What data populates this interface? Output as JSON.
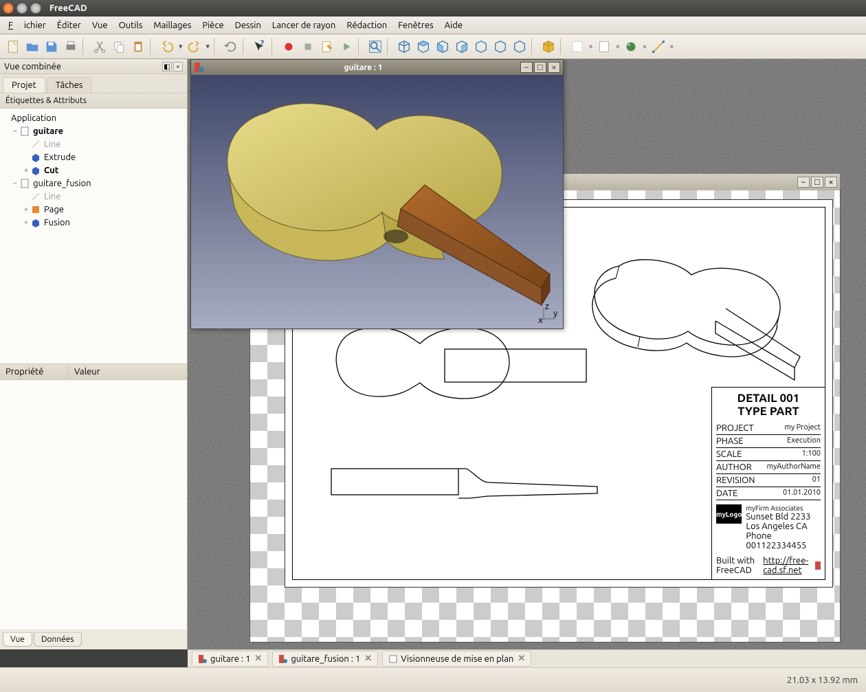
{
  "app": {
    "title": "FreeCAD"
  },
  "menu": {
    "file": "Fichier",
    "edit": "Éditer",
    "view": "Vue",
    "tools": "Outils",
    "mesh": "Maillages",
    "part": "Pièce",
    "drawing": "Dessin",
    "ray": "Lancer de rayon",
    "draft": "Rédaction",
    "windows": "Fenêtres",
    "help": "Aide"
  },
  "sidebar": {
    "panel_title": "Vue combinée",
    "tab_project": "Projet",
    "tab_tasks": "Tâches",
    "section": "Étiquettes & Attributs",
    "root": "Application",
    "doc1": "guitare",
    "doc1_items": [
      "Line",
      "Extrude",
      "Cut"
    ],
    "doc2": "guitare_fusion",
    "doc2_items": [
      "Line",
      "Page",
      "Fusion"
    ],
    "prop_col1": "Propriété",
    "prop_col2": "Valeur",
    "btab_view": "Vue",
    "btab_data": "Données"
  },
  "view3d": {
    "title": "guitare : 1"
  },
  "drawing_window": {
    "title_fragment": "en plan"
  },
  "titleblock": {
    "detail": "DETAIL 001",
    "type": "TYPE PART",
    "rows": [
      {
        "label": "PROJECT",
        "value": "my Project"
      },
      {
        "label": "PHASE",
        "value": "Execution"
      },
      {
        "label": "SCALE",
        "value": "1:100"
      },
      {
        "label": "AUTHOR",
        "value": "myAuthorName"
      },
      {
        "label": "REVISION",
        "value": "01"
      },
      {
        "label": "DATE",
        "value": "01.01.2010"
      }
    ],
    "logo_text": "myLogo",
    "firm": "myFirm Associates",
    "addr1": "Sunset Bld 2233",
    "addr2": "Los Angeles CA",
    "addr3": "Phone 001122334455",
    "credit": "Built with FreeCAD",
    "credit_url": "http://free-cad.sf.net"
  },
  "doctabs": [
    {
      "label": "guitare : 1"
    },
    {
      "label": "guitare_fusion : 1"
    },
    {
      "label": "Visionneuse de mise en plan"
    }
  ],
  "status": {
    "coords": "21.03 x 13.92 mm"
  }
}
